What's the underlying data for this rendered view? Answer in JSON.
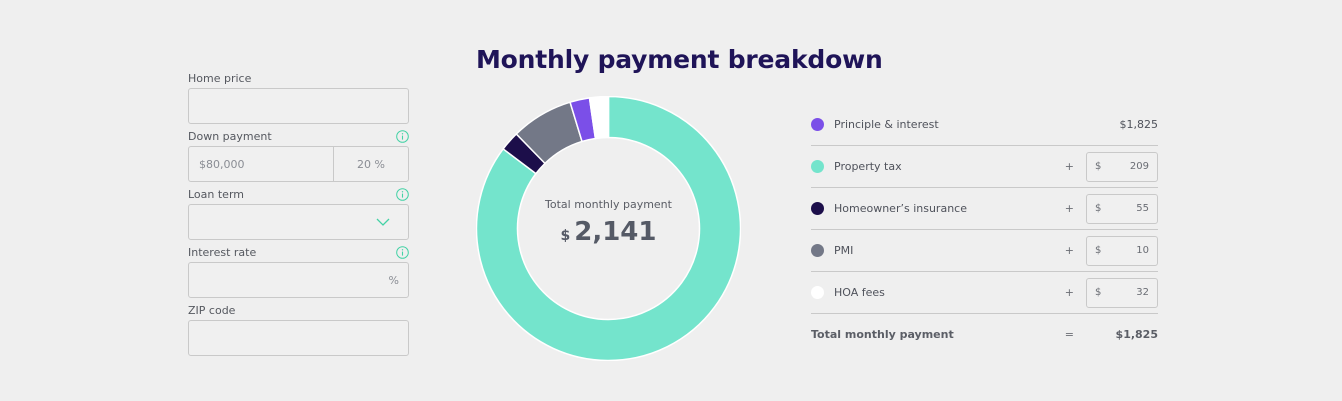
{
  "form": {
    "home_price_label": "Home price",
    "home_price_value": "",
    "down_payment_label": "Down payment",
    "down_payment_amount": "$80,000",
    "down_payment_percent": "20 %",
    "loan_term_label": "Loan term",
    "loan_term_value": "",
    "interest_rate_label": "Interest rate",
    "interest_rate_unit": "%",
    "zip_label": "ZIP code",
    "zip_value": ""
  },
  "title": "Monthly payment breakdown",
  "donut": {
    "center_label": "Total monthly payment",
    "currency": "$",
    "amount": "2,141"
  },
  "breakdown": {
    "rows": [
      {
        "label": "Principle & interest",
        "value": "$1,825",
        "color": "#7b4fe8"
      },
      {
        "label": "Property tax",
        "currency": "$",
        "value": "209",
        "color": "#74e4cc"
      },
      {
        "label": "Homeowner’s insurance",
        "currency": "$",
        "value": "55",
        "color": "#1c0e4a"
      },
      {
        "label": "PMI",
        "currency": "$",
        "value": "10",
        "color": "#737887"
      },
      {
        "label": "HOA fees",
        "currency": "$",
        "value": "32",
        "color": "#ffffff"
      }
    ],
    "plus": "+",
    "total_label": "Total monthly payment",
    "equals": "=",
    "total_value": "$1,825"
  },
  "chart_data": {
    "type": "pie",
    "categories": [
      "Property tax",
      "Homeowner’s insurance",
      "PMI",
      "Principle & interest",
      "HOA fees"
    ],
    "values": [
      85.3,
      2.4,
      7.6,
      2.4,
      2.3
    ],
    "colors": [
      "#74e4cc",
      "#1c0e4a",
      "#737887",
      "#7b4fe8",
      "#ffffff"
    ]
  }
}
